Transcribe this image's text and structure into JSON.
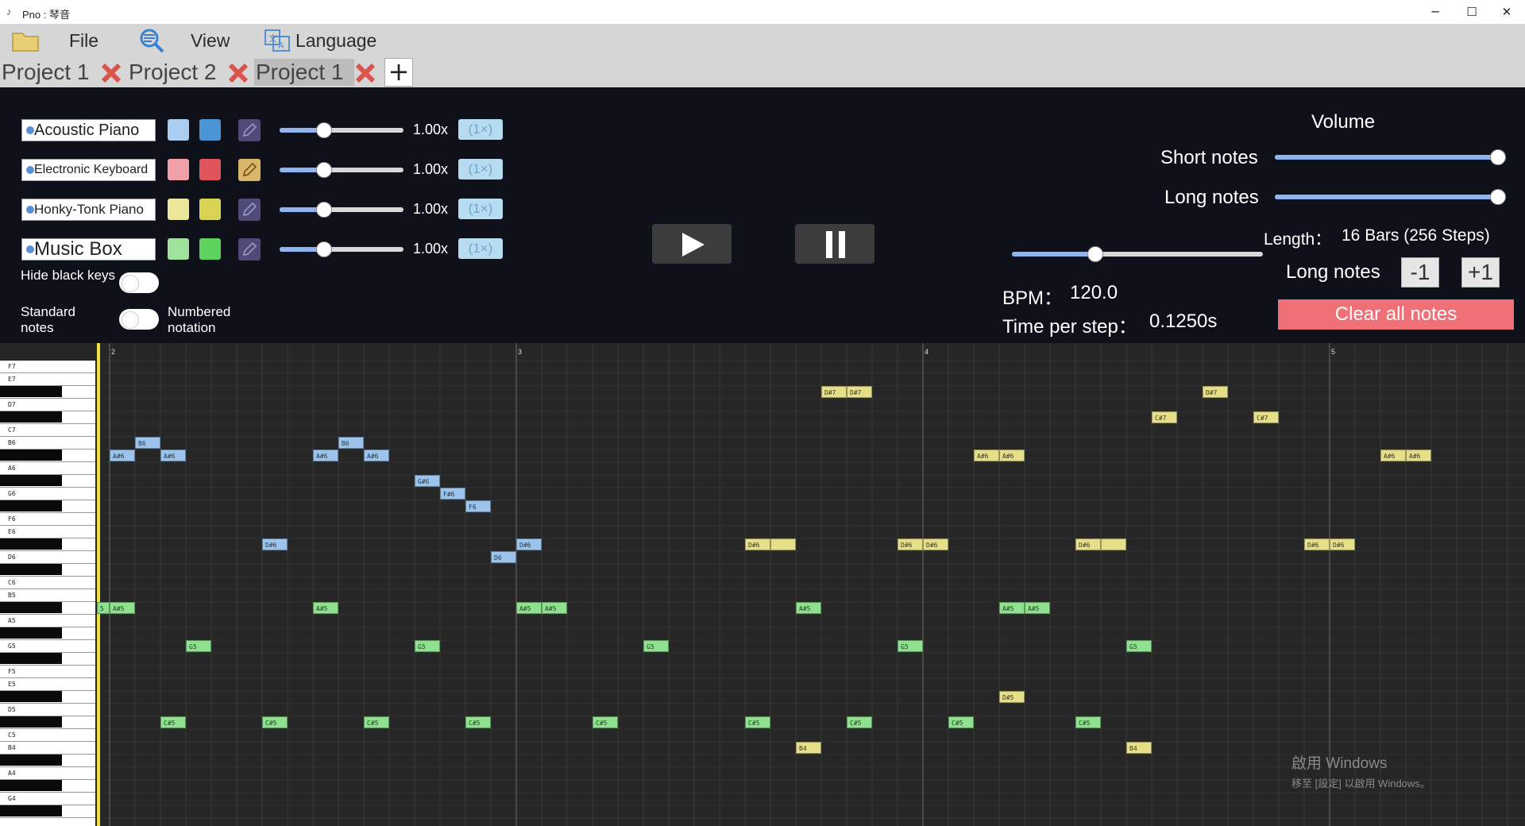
{
  "window": {
    "title": "Pno : 琴音",
    "minimize": "─",
    "maximize": "☐",
    "close": "✕"
  },
  "menu": {
    "file": "File",
    "view": "View",
    "language": "Language"
  },
  "tabs": [
    "Project 1",
    "Project 2",
    "Project 1"
  ],
  "add_tab": "+",
  "instruments": [
    {
      "name": "Acoustic Piano",
      "color_light": "#a8cdf0",
      "color_dark": "#4b94d6",
      "speed": "1.00x",
      "mult": "(1×)",
      "speed_value": 0.35
    },
    {
      "name": "Electronic Keyboard",
      "color_light": "#f0a0a6",
      "color_dark": "#e0555c",
      "speed": "1.00x",
      "mult": "(1×)",
      "speed_value": 0.35
    },
    {
      "name": "Honky-Tonk Piano",
      "color_light": "#ece79a",
      "color_dark": "#d8d355",
      "speed": "1.00x",
      "mult": "(1×)",
      "speed_value": 0.35
    },
    {
      "name": "Music Box",
      "color_light": "#9ee29e",
      "color_dark": "#5cd35c",
      "speed": "1.00x",
      "mult": "(1×)",
      "speed_value": 0.35
    }
  ],
  "toggles": {
    "hide_black": "Hide black keys",
    "standard": "Standard notes",
    "numbered": "Numbered notation"
  },
  "volume": {
    "title": "Volume",
    "short": "Short notes",
    "long": "Long notes",
    "short_value": 1.0,
    "long_value": 1.0
  },
  "length": {
    "label": "Length：",
    "value": "16 Bars (256 Steps)"
  },
  "long_notes": {
    "label": "Long notes",
    "minus": "-1",
    "plus": "+1"
  },
  "bpm": {
    "label": "BPM：",
    "value": "120.0",
    "slider_value": 0.33
  },
  "time_per_step": {
    "label": "Time per step：",
    "value": "0.1250s"
  },
  "clear": "Clear all notes",
  "bars": [
    "2",
    "3",
    "4",
    "5"
  ],
  "key_labels": [
    "F7",
    "E7",
    "D7",
    "C7",
    "B6",
    "A6",
    "G6",
    "F6",
    "E6",
    "D6",
    "C6",
    "B5",
    "A5",
    "G5",
    "F5",
    "E5",
    "D5",
    "C5",
    "B4",
    "A4",
    "G4"
  ],
  "notes": [
    {
      "n": "D#7",
      "c": "y"
    },
    {
      "n": "D#7",
      "c": "y"
    },
    {
      "n": "D#7",
      "c": "y"
    },
    {
      "n": "C#7",
      "c": "y"
    },
    {
      "n": "C#7",
      "c": "y"
    },
    {
      "n": "B6",
      "c": "b"
    },
    {
      "n": "B6",
      "c": "b"
    },
    {
      "n": "A#6",
      "c": "b"
    },
    {
      "n": "A#6",
      "c": "b"
    },
    {
      "n": "A#6",
      "c": "b"
    },
    {
      "n": "A#6",
      "c": "b"
    },
    {
      "n": "A#6",
      "c": "y"
    },
    {
      "n": "A#6",
      "c": "y"
    },
    {
      "n": "A#6",
      "c": "y"
    },
    {
      "n": "A#6",
      "c": "y"
    },
    {
      "n": "G#6",
      "c": "b"
    },
    {
      "n": "F#6",
      "c": "b"
    },
    {
      "n": "F6",
      "c": "b"
    },
    {
      "n": "D#6",
      "c": "b"
    },
    {
      "n": "D#6",
      "c": "b"
    },
    {
      "n": "D6",
      "c": "b"
    },
    {
      "n": "D#6",
      "c": "y"
    },
    {
      "n": "",
      "c": "y"
    },
    {
      "n": "D#6",
      "c": "y"
    },
    {
      "n": "D#6",
      "c": "y"
    },
    {
      "n": "D#6",
      "c": "y"
    },
    {
      "n": "",
      "c": "y"
    },
    {
      "n": "D#6",
      "c": "y"
    },
    {
      "n": "D#6",
      "c": "y"
    },
    {
      "n": "5",
      "c": "g"
    },
    {
      "n": "A#5",
      "c": "g"
    },
    {
      "n": "A#5",
      "c": "g"
    },
    {
      "n": "A#5",
      "c": "g"
    },
    {
      "n": "A#5",
      "c": "g"
    },
    {
      "n": "A#5",
      "c": "g"
    },
    {
      "n": "A#5",
      "c": "g"
    },
    {
      "n": "A#5",
      "c": "g"
    },
    {
      "n": "G5",
      "c": "g"
    },
    {
      "n": "G5",
      "c": "g"
    },
    {
      "n": "G5",
      "c": "g"
    },
    {
      "n": "G5",
      "c": "g"
    },
    {
      "n": "G5",
      "c": "g"
    },
    {
      "n": "D#5",
      "c": "y"
    },
    {
      "n": "C#5",
      "c": "g"
    },
    {
      "n": "C#5",
      "c": "g"
    },
    {
      "n": "C#5",
      "c": "g"
    },
    {
      "n": "C#5",
      "c": "g"
    },
    {
      "n": "C#5",
      "c": "g"
    },
    {
      "n": "C#5",
      "c": "g"
    },
    {
      "n": "C#5",
      "c": "g"
    },
    {
      "n": "C#5",
      "c": "g"
    },
    {
      "n": "C#5",
      "c": "g"
    },
    {
      "n": "B4",
      "c": "y"
    },
    {
      "n": "B4",
      "c": "y"
    }
  ],
  "watermark": {
    "line1": "啟用 Windows",
    "line2": "移至 [設定] 以啟用 Windows。"
  }
}
